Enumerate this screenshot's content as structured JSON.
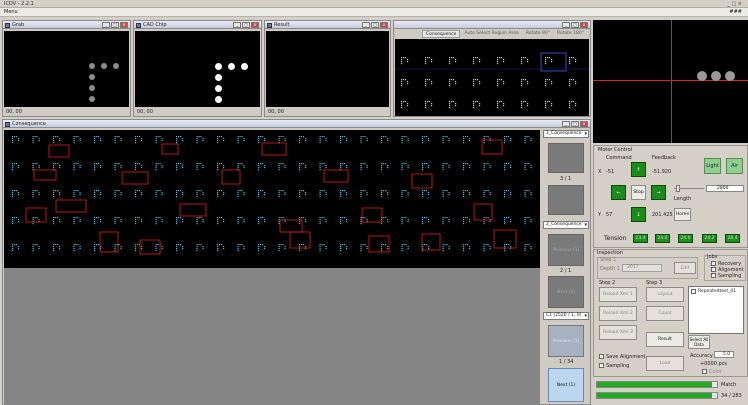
{
  "app": {
    "title": "ICDV - 2.2.1",
    "title_right": "_ □ ×"
  },
  "menu": {
    "items": [
      "Menu"
    ],
    "right": "###"
  },
  "colors": {
    "accent_green": "#1c8a1c",
    "light_green": "#8ecf8e",
    "alarm_red": "#e02020",
    "cyan_dots": "#4fb8d8"
  },
  "windows": {
    "grab": {
      "title": "Grab",
      "coord": "00, 00"
    },
    "cad_chip": {
      "title": "CAD Chip",
      "coord": "00, 00"
    },
    "result": {
      "title": "Result",
      "coord": "00, 00"
    },
    "consequence_top": {
      "tabs": [
        "Consequence",
        "Auto Select Region Area",
        "Rotate 90°",
        "Rotate 180°"
      ]
    },
    "consequence_main": {
      "title": "Consequence"
    }
  },
  "side": {
    "select1": "1_Consequence",
    "count1": "3 / 1",
    "select2": "2_Consequence",
    "previous_label": "Previous (1)",
    "count2": "2 / 1",
    "next_label": "Next (1)",
    "select3": "C1 (2520 / 1, 0)",
    "previous2_label": "Previous (1)",
    "count3": "1 / 34",
    "next_bottom": "Next (1)"
  },
  "motor": {
    "title": "Motor Control",
    "col_command": "Command",
    "col_feedback": "Feedback",
    "x_label": "X",
    "x_val": "-51",
    "x_feedback": "-51.920",
    "y_label": "Y",
    "y_val": "57",
    "y_feedback": "201.425",
    "stop": "Stop",
    "home": "Home",
    "light": "Light",
    "air": "Air",
    "length_label": "Length",
    "speed_val": "2800",
    "up_arrow": "↑",
    "down_arrow": "↓",
    "left_arrow": "←",
    "right_arrow": "→"
  },
  "tension": {
    "label": "Tension",
    "values": [
      "23.4",
      "24.0",
      "24.0",
      "24.2",
      "26.4"
    ]
  },
  "inspection": {
    "title": "Inspection",
    "step1_group": "Step 1",
    "depth_label": "Depth 1",
    "depth_value": "2017",
    "edit": "Edit",
    "step2": "Step 2",
    "step3": "Step 3",
    "reload_buttons": [
      "Reload Xml 1",
      "Reload Xml 2",
      "Reload Xml 3"
    ],
    "step3_buttons": [
      "Layout",
      "Count",
      "Result"
    ],
    "save_alignment": "Save Alignment",
    "sampling": "Sampling",
    "load": "Load",
    "select_all": "Select All Data",
    "list_item": "Repeatedtest_01",
    "jobs": {
      "title": "Jobs",
      "items": [
        "Recovery",
        "Alignment",
        "Sampling"
      ]
    },
    "accuracy_label": "Accuracy",
    "accuracy_val": "5.0",
    "pitch_label": "+0000 pcs",
    "color_label": "Color"
  },
  "progress": [
    {
      "label": "Match",
      "fraction": 0.96
    },
    {
      "label": "34 / 283",
      "fraction": 0.96
    }
  ]
}
